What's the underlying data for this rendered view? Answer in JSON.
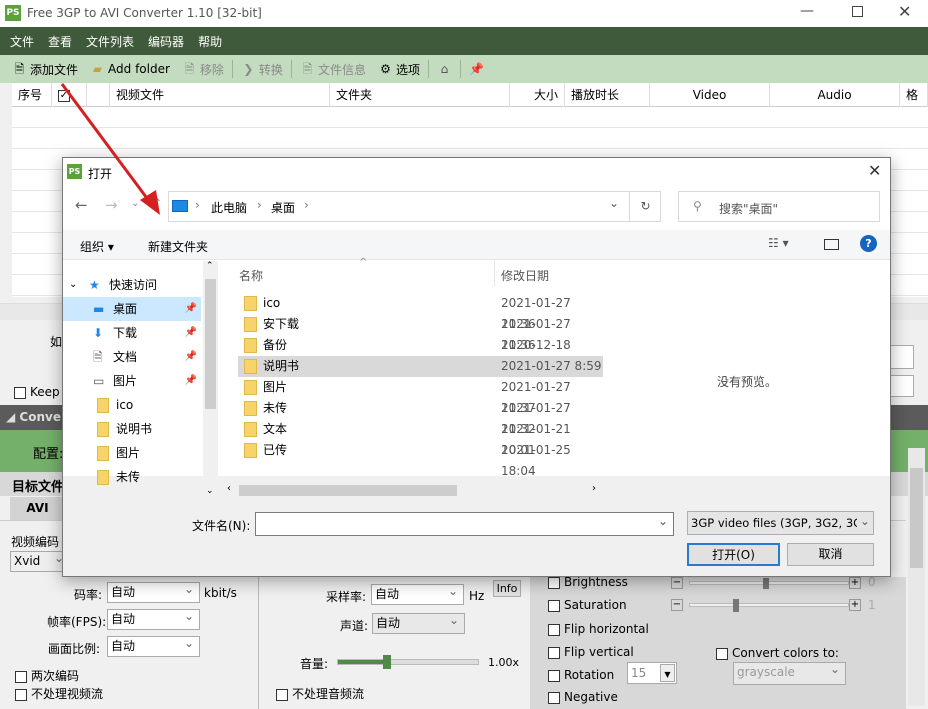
{
  "window": {
    "title": "Free 3GP to AVI Converter 1.10  [32-bit]",
    "app_icon": "PS"
  },
  "menu": [
    "文件",
    "查看",
    "文件列表",
    "编码器",
    "帮助"
  ],
  "toolbar": {
    "add_file": "添加文件",
    "add_folder": "Add folder",
    "remove": "移除",
    "convert": "转换",
    "file_info": "文件信息",
    "options": "选项"
  },
  "table": {
    "columns": [
      "序号",
      "",
      "视频文件",
      "文件夹",
      "大小",
      "播放时长",
      "Video",
      "Audio",
      "格"
    ]
  },
  "left_panel": {
    "partial_label": "如",
    "keep": "Keep t",
    "conversion_header": "Convers",
    "profile_label": "配置:",
    "target_label": "目标文件",
    "tab": "AVI",
    "video_codec_label": "视频编码",
    "video_codec": "Xvid",
    "bitrate_label": "码率:",
    "bitrate": "自动",
    "bitrate_unit": "kbit/s",
    "fps_label": "帧率(FPS):",
    "fps": "自动",
    "aspect_label": "画面比例:",
    "aspect": "自动",
    "two_pass": "两次编码",
    "no_video": "不处理视频流"
  },
  "audio_panel": {
    "samplerate_label": "采样率:",
    "samplerate": "自动",
    "samplerate_unit": "Hz",
    "info": "Info",
    "channels_label": "声道:",
    "channels": "自动",
    "volume_label": "音量:",
    "volume": "1.00x",
    "volume_level": 0.35,
    "no_audio": "不处理音频流"
  },
  "filters": {
    "brightness": "Brightness",
    "brightness_value": "0",
    "saturation": "Saturation",
    "saturation_value": "1",
    "flip_h": "Flip horizontal",
    "flip_v": "Flip vertical",
    "rotation": "Rotation",
    "rotation_value": "15",
    "negative": "Negative",
    "convert_colors": "Convert colors to:",
    "color_mode": "grayscale"
  },
  "dialog": {
    "title": "打开",
    "breadcrumb": [
      "此电脑",
      "桌面"
    ],
    "search_placeholder": "搜索\"桌面\"",
    "organize": "组织",
    "new_folder": "新建文件夹",
    "nav": [
      {
        "label": "快速访问",
        "type": "star"
      },
      {
        "label": "桌面",
        "type": "desktop",
        "pinned": true,
        "selected": true
      },
      {
        "label": "下载",
        "type": "download",
        "pinned": true
      },
      {
        "label": "文档",
        "type": "doc",
        "pinned": true
      },
      {
        "label": "图片",
        "type": "pic",
        "pinned": true
      },
      {
        "label": "ico",
        "type": "folder"
      },
      {
        "label": "说明书",
        "type": "folder"
      },
      {
        "label": "图片",
        "type": "folder"
      },
      {
        "label": "未传",
        "type": "folder"
      }
    ],
    "col_name": "名称",
    "col_date": "修改日期",
    "files": [
      {
        "name": "ico",
        "date": "2021-01-27 11:36"
      },
      {
        "name": "安下载",
        "date": "2021-01-27 11:36"
      },
      {
        "name": "备份",
        "date": "2020-12-18 13:03"
      },
      {
        "name": "说明书",
        "date": "2021-01-27 8:59"
      },
      {
        "name": "图片",
        "date": "2021-01-27 11:37"
      },
      {
        "name": "未传",
        "date": "2021-01-27 11:32"
      },
      {
        "name": "文本",
        "date": "2021-01-21 10:01"
      },
      {
        "name": "已传",
        "date": "2021-01-25 18:04"
      }
    ],
    "no_preview": "没有预览。",
    "filename_label": "文件名(N):",
    "filename": "",
    "filetype": "3GP video files (3GP, 3G2, 3G",
    "open": "打开(O)",
    "cancel": "取消"
  },
  "colors": {
    "menubar": "#3f5a3a",
    "toolbar": "#c3dbbf",
    "accent_green": "#4f8a46",
    "arrow": "#d42020"
  }
}
